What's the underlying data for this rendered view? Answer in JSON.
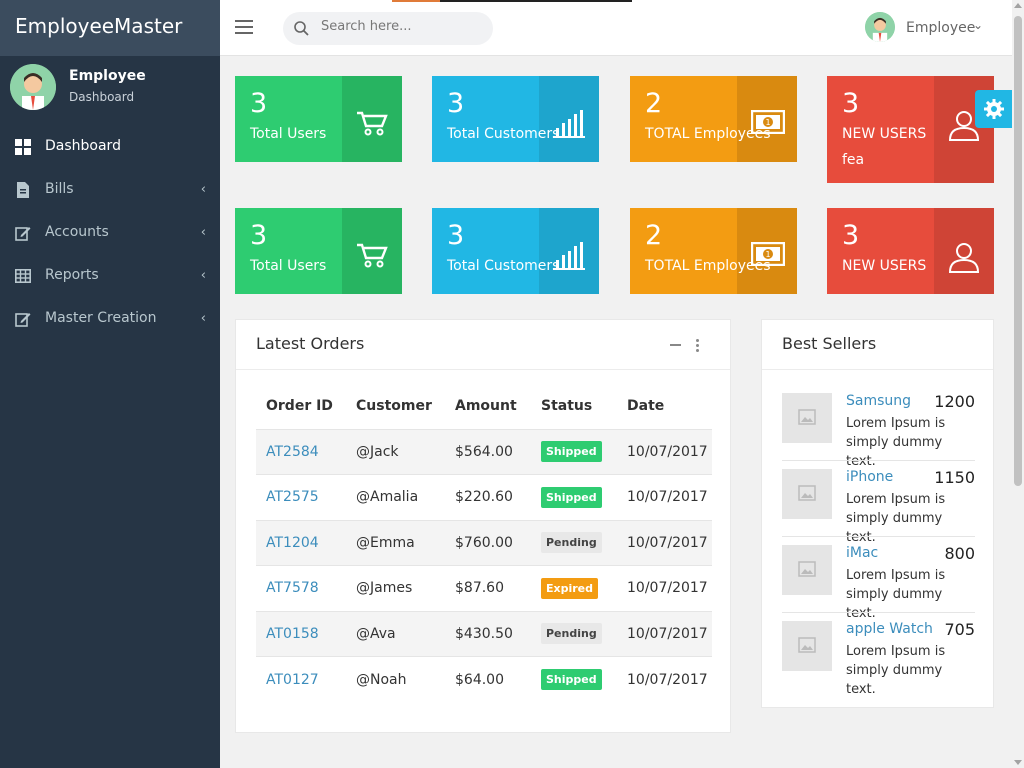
{
  "app": {
    "brand": "EmployeeMaster"
  },
  "user_panel": {
    "name": "Employee",
    "role": "Dashboard"
  },
  "sidebar": {
    "items": [
      {
        "label": "Dashboard",
        "icon": "grid-icon",
        "active": true
      },
      {
        "label": "Bills",
        "icon": "file-icon"
      },
      {
        "label": "Accounts",
        "icon": "edit-icon"
      },
      {
        "label": "Reports",
        "icon": "table-icon"
      },
      {
        "label": "Master Creation",
        "icon": "edit-icon"
      }
    ]
  },
  "topbar": {
    "search_placeholder": "Search here...",
    "user_name": "Employee"
  },
  "cards": [
    {
      "value": "3",
      "label": "Total Users",
      "icon": "cart-icon",
      "color": "#2ecc71"
    },
    {
      "value": "3",
      "label": "Total Customers",
      "icon": "bar-chart-icon",
      "color": "#21b7e4"
    },
    {
      "value": "2",
      "label": "TOTAL Employees",
      "icon": "money-icon",
      "color": "#f39c12"
    },
    {
      "value": "3",
      "label": "NEW USERS",
      "extra": "fea",
      "icon": "user-icon",
      "color": "#e74c3c"
    },
    {
      "value": "3",
      "label": "Total Users",
      "icon": "cart-icon",
      "color": "#2ecc71"
    },
    {
      "value": "3",
      "label": "Total Customers",
      "icon": "bar-chart-icon",
      "color": "#21b7e4"
    },
    {
      "value": "2",
      "label": "TOTAL Employees",
      "icon": "money-icon",
      "color": "#f39c12"
    },
    {
      "value": "3",
      "label": "NEW USERS",
      "icon": "user-icon",
      "color": "#e74c3c"
    }
  ],
  "orders": {
    "title": "Latest Orders",
    "columns": [
      "Order ID",
      "Customer",
      "Amount",
      "Status",
      "Date"
    ],
    "rows": [
      {
        "id": "AT2584",
        "customer": "@Jack",
        "amount": "$564.00",
        "status": "Shipped",
        "date": "10/07/2017"
      },
      {
        "id": "AT2575",
        "customer": "@Amalia",
        "amount": "$220.60",
        "status": "Shipped",
        "date": "10/07/2017"
      },
      {
        "id": "AT1204",
        "customer": "@Emma",
        "amount": "$760.00",
        "status": "Pending",
        "date": "10/07/2017"
      },
      {
        "id": "AT7578",
        "customer": "@James",
        "amount": "$87.60",
        "status": "Expired",
        "date": "10/07/2017"
      },
      {
        "id": "AT0158",
        "customer": "@Ava",
        "amount": "$430.50",
        "status": "Pending",
        "date": "10/07/2017"
      },
      {
        "id": "AT0127",
        "customer": "@Noah",
        "amount": "$64.00",
        "status": "Shipped",
        "date": "10/07/2017"
      }
    ]
  },
  "best_sellers": {
    "title": "Best Sellers",
    "items": [
      {
        "name": "Samsung",
        "value": "1200",
        "desc": "Lorem Ipsum is simply dummy text."
      },
      {
        "name": "iPhone",
        "value": "1150",
        "desc": "Lorem Ipsum is simply dummy text."
      },
      {
        "name": "iMac",
        "value": "800",
        "desc": "Lorem Ipsum is simply dummy text."
      },
      {
        "name": "apple Watch",
        "value": "705",
        "desc": "Lorem Ipsum is simply dummy text."
      }
    ]
  }
}
